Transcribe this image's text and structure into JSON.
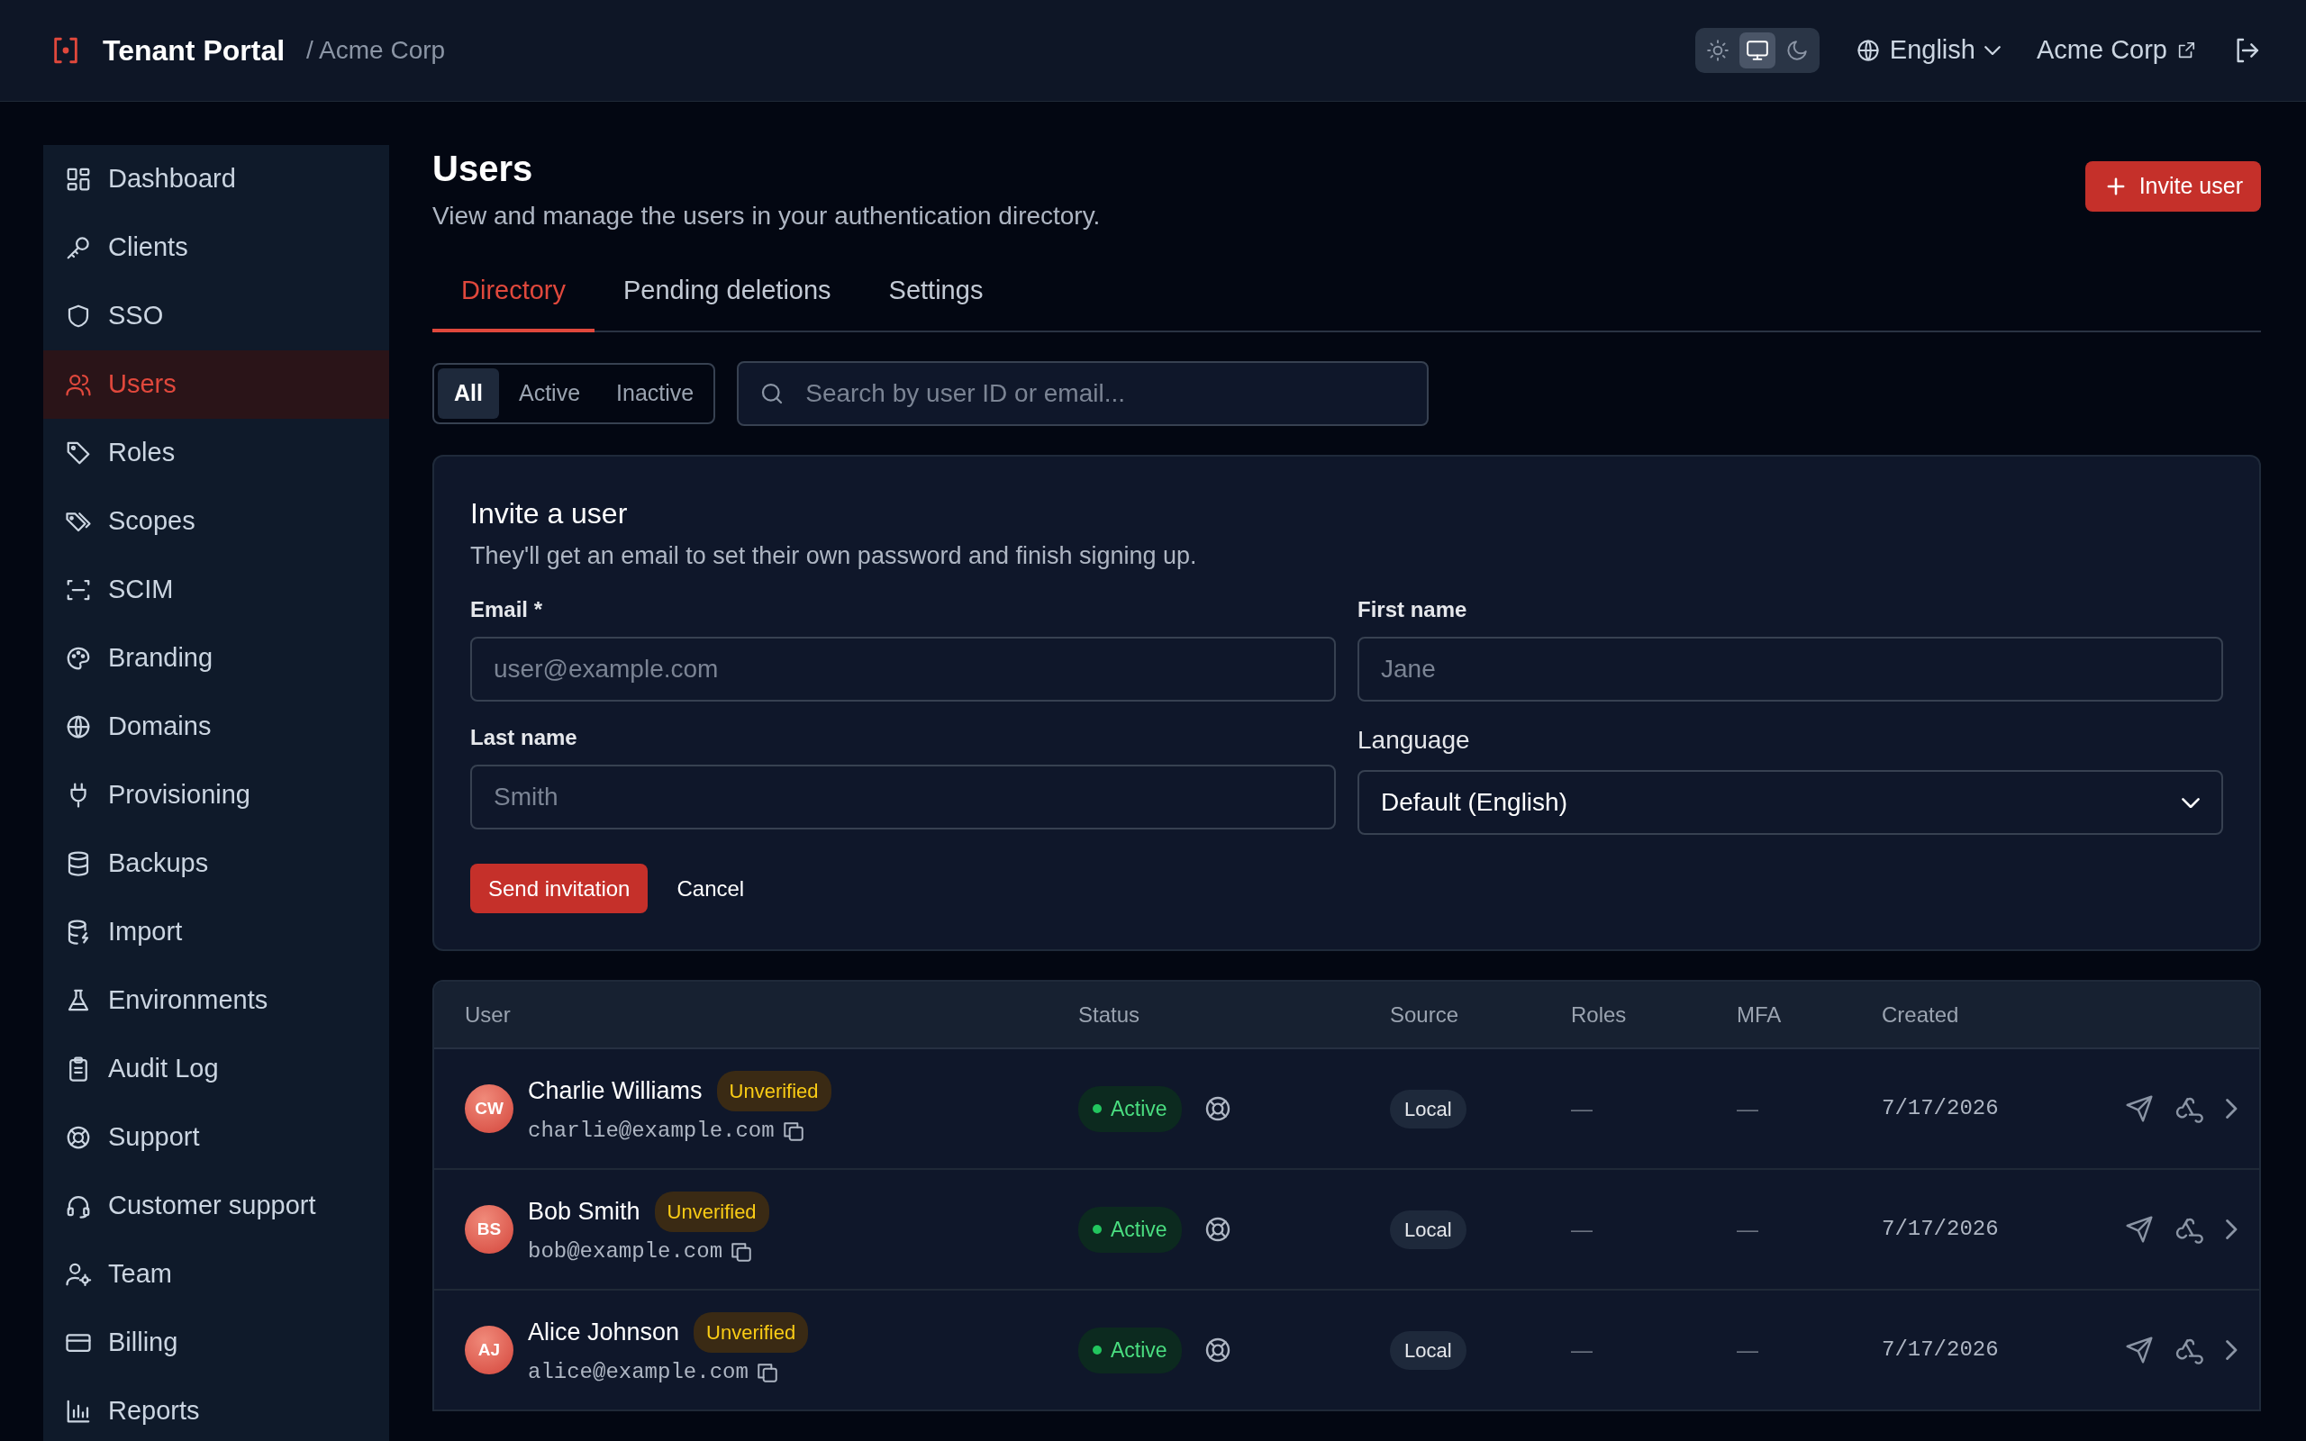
{
  "header": {
    "brand": "Tenant Portal",
    "tenant": "/ Acme Corp",
    "theme_modes": [
      {
        "selected": false
      },
      {
        "selected": true
      },
      {
        "selected": false
      }
    ],
    "language": "English",
    "account": "Acme Corp"
  },
  "sidebar": {
    "items": [
      {
        "label": "Dashboard",
        "selected": false
      },
      {
        "label": "Clients",
        "selected": false
      },
      {
        "label": "SSO",
        "selected": false
      },
      {
        "label": "Users",
        "selected": true
      },
      {
        "label": "Roles",
        "selected": false
      },
      {
        "label": "Scopes",
        "selected": false
      },
      {
        "label": "SCIM",
        "selected": false
      },
      {
        "label": "Branding",
        "selected": false
      },
      {
        "label": "Domains",
        "selected": false
      },
      {
        "label": "Provisioning",
        "selected": false
      },
      {
        "label": "Backups",
        "selected": false
      },
      {
        "label": "Import",
        "selected": false
      },
      {
        "label": "Environments",
        "selected": false
      },
      {
        "label": "Audit Log",
        "selected": false
      },
      {
        "label": "Support",
        "selected": false
      },
      {
        "label": "Customer support",
        "selected": false
      },
      {
        "label": "Team",
        "selected": false
      },
      {
        "label": "Billing",
        "selected": false
      },
      {
        "label": "Reports",
        "selected": false
      }
    ]
  },
  "page": {
    "title": "Users",
    "subtitle": "View and manage the users in your authentication directory.",
    "invite_button": "Invite user"
  },
  "tabs": [
    {
      "label": "Directory",
      "selected": true
    },
    {
      "label": "Pending deletions",
      "selected": false
    },
    {
      "label": "Settings",
      "selected": false
    }
  ],
  "filters": [
    {
      "label": "All",
      "selected": true
    },
    {
      "label": "Active",
      "selected": false
    },
    {
      "label": "Inactive",
      "selected": false
    }
  ],
  "search": {
    "placeholder": "Search by user ID or email..."
  },
  "invite_form": {
    "title": "Invite a user",
    "subtitle": "They'll get an email to set their own password and finish signing up.",
    "fields": [
      {
        "kind": "input",
        "label": "Email *",
        "placeholder": "user@example.com"
      },
      {
        "kind": "input",
        "label": "First name",
        "placeholder": "Jane"
      },
      {
        "kind": "input",
        "label": "Last name",
        "placeholder": "Smith"
      },
      {
        "kind": "select",
        "label": "Language",
        "value": "Default (English)"
      }
    ],
    "submit": "Send invitation",
    "cancel": "Cancel"
  },
  "table": {
    "columns": [
      "User",
      "Status",
      "Source",
      "Roles",
      "MFA",
      "Created"
    ],
    "rows": [
      {
        "initials": "CW",
        "name": "Charlie Williams",
        "badge": "Unverified",
        "email": "charlie@example.com",
        "status": "Active",
        "source": "Local",
        "roles": "—",
        "mfa": "—",
        "created": "7/17/2026"
      },
      {
        "initials": "BS",
        "name": "Bob Smith",
        "badge": "Unverified",
        "email": "bob@example.com",
        "status": "Active",
        "source": "Local",
        "roles": "—",
        "mfa": "—",
        "created": "7/17/2026"
      },
      {
        "initials": "AJ",
        "name": "Alice Johnson",
        "badge": "Unverified",
        "email": "alice@example.com",
        "status": "Active",
        "source": "Local",
        "roles": "—",
        "mfa": "—",
        "created": "7/17/2026"
      }
    ]
  }
}
